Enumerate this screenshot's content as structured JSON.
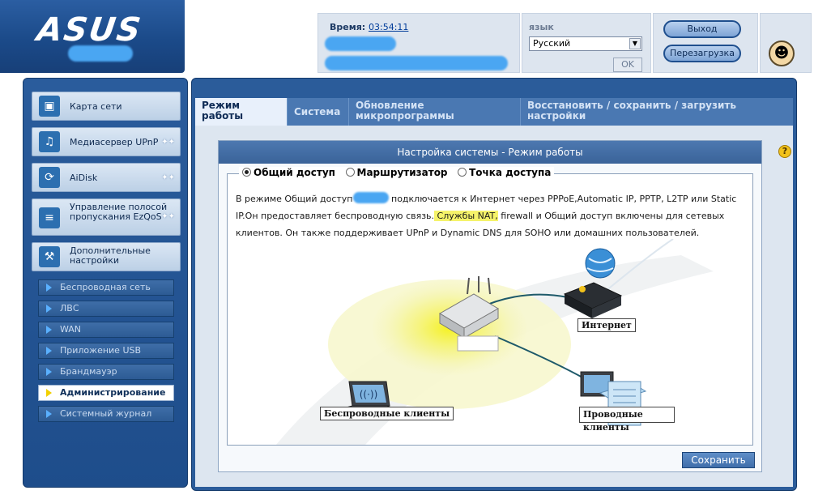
{
  "header": {
    "brand": "ASUS",
    "time_label": "Время:",
    "time_value": "03:54:11",
    "lang_label": "язык",
    "lang_selected": "Русский",
    "ok_label": "OK",
    "logout_label": "Выход",
    "reboot_label": "Перезагрузка",
    "colors": {
      "brand_blue": "#1e4d8b",
      "panel_bg": "#dde5ef"
    }
  },
  "sidebar": {
    "main_items": [
      {
        "label": "Карта сети",
        "icon": "network-map-icon"
      },
      {
        "label": "Медиасервер UPnP",
        "icon": "media-server-icon"
      },
      {
        "label": "AiDisk",
        "icon": "aidisk-icon"
      },
      {
        "label": "Управление полосой пропускания EzQoS",
        "icon": "qos-icon"
      },
      {
        "label": "Дополнительные настройки",
        "icon": "tools-icon"
      }
    ],
    "sub_items": [
      {
        "label": "Беспроводная сеть"
      },
      {
        "label": "ЛВС"
      },
      {
        "label": "WAN"
      },
      {
        "label": "Приложение USB"
      },
      {
        "label": "Брандмауэр"
      },
      {
        "label": "Администрирование",
        "active": true
      },
      {
        "label": "Системный журнал"
      }
    ]
  },
  "tabs": [
    {
      "label": "Режим работы",
      "active": true
    },
    {
      "label": "Система"
    },
    {
      "label": "Обновление микропрограммы"
    },
    {
      "label": "Восстановить / сохранить / загрузить настройки"
    }
  ],
  "panel": {
    "title": "Настройка системы - Режим работы",
    "modes": [
      {
        "label": "Общий доступ",
        "checked": true
      },
      {
        "label": "Маршрутизатор",
        "checked": false
      },
      {
        "label": "Точка доступа",
        "checked": false
      }
    ],
    "description": {
      "part1": "В режиме Общий доступ",
      "part2": " подключается к Интернет через PPPoE,Automatic IP, PPTP, L2TP или Static IP.Он предоставляет беспроводную связь.",
      "highlight": " Службы NAT,",
      "part3": " firewall и Общий доступ включены для сетевых клиентов. Он также поддерживает UPnP и Dynamic DNS для SOHO или домашних пользователей."
    },
    "diagram": {
      "internet_label": "Интернет",
      "wireless_label": "Беспроводные клиенты",
      "wired_label": "Проводные клиенты"
    },
    "save_label": "Сохранить"
  }
}
